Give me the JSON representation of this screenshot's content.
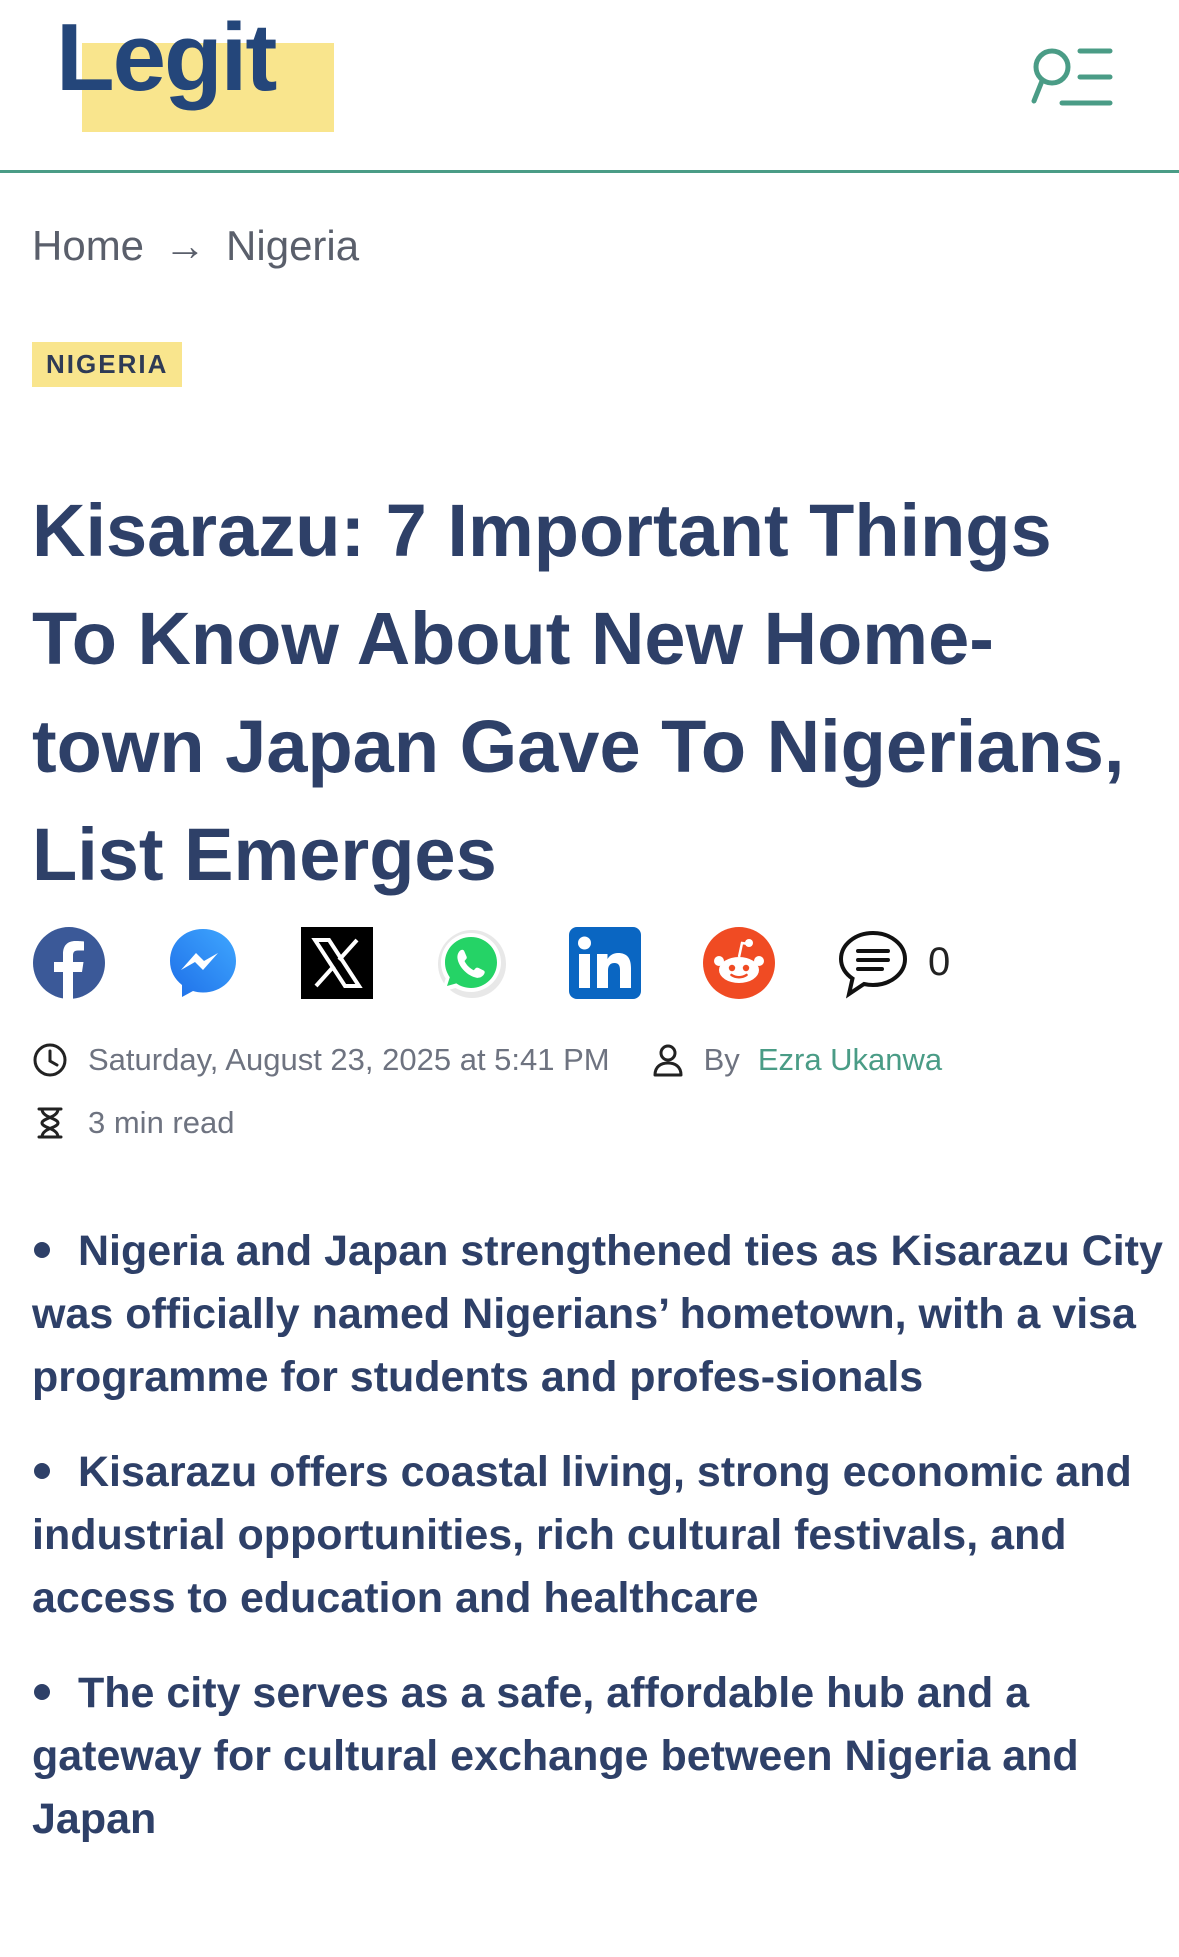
{
  "header": {
    "logo_text": "Legit",
    "menu_icon": "search-menu-icon"
  },
  "breadcrumb": {
    "home": "Home",
    "separator": "→",
    "section": "Nigeria"
  },
  "category": "NIGERIA",
  "article": {
    "title": "Kisarazu: 7 Important Things To Know About New Home-town Japan Gave To Nigerians, List Emerges",
    "date": "Saturday, August 23, 2025 at 5:41 PM",
    "by_label": "By",
    "author": "Ezra Ukanwa",
    "read_time": "3 min read",
    "highlights": [
      "Nigeria and Japan strengthened ties as Kisarazu City was officially named Nigerians’ hometown, with a visa programme for students and profes-sionals",
      "Kisarazu offers coastal living, strong economic and industrial opportunities, rich cultural festivals, and access to education and healthcare",
      "The city serves as a safe, affordable hub and a gateway for cultural exchange between Nigeria and Japan"
    ]
  },
  "share": {
    "icons": [
      "facebook-icon",
      "messenger-icon",
      "x-icon",
      "whatsapp-icon",
      "linkedin-icon",
      "reddit-icon",
      "comment-icon"
    ],
    "comment_count": "0"
  },
  "colors": {
    "brand_blue": "#24467a",
    "highlight_yellow": "#f9e58d",
    "accent_green": "#4a9c86",
    "text_navy": "#2e4068"
  }
}
